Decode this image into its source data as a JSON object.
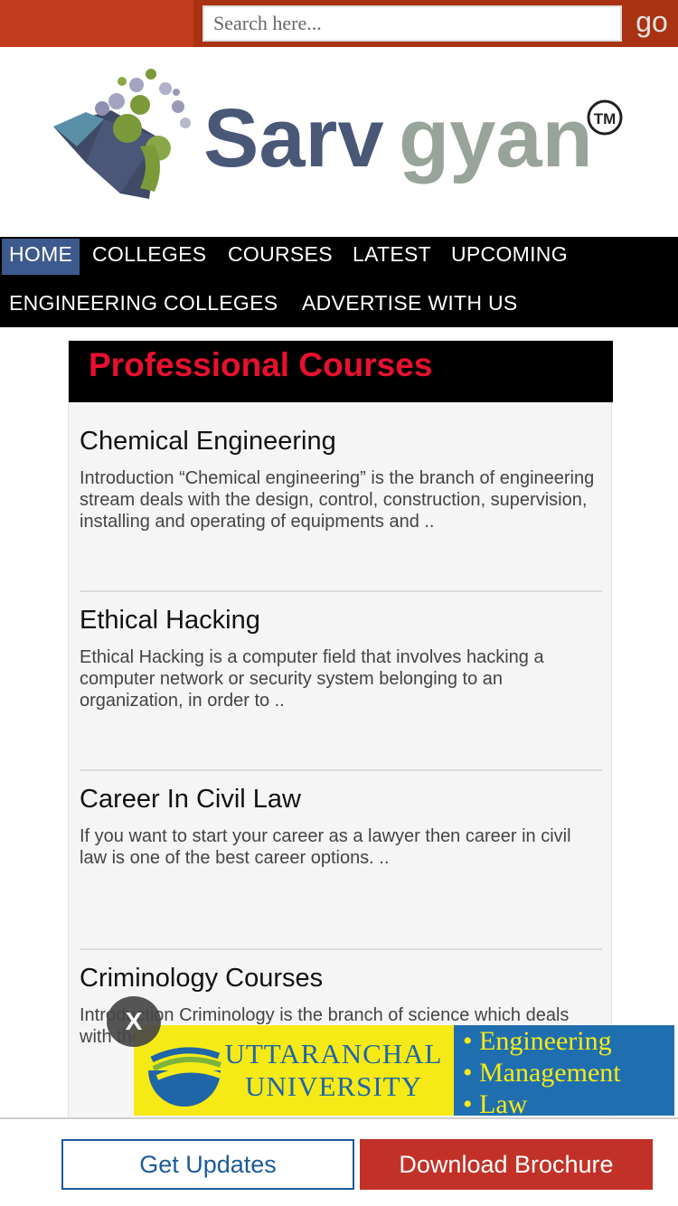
{
  "search": {
    "placeholder": "Search here...",
    "go_label": "go"
  },
  "logo": {
    "brand_part1": "Sarv",
    "brand_part2": "gyan",
    "trademark": "TM"
  },
  "nav": {
    "items": [
      {
        "label": "HOME",
        "active": true
      },
      {
        "label": "COLLEGES"
      },
      {
        "label": "COURSES"
      },
      {
        "label": "LATEST"
      },
      {
        "label": "UPCOMING"
      },
      {
        "label": "ENGINEERING COLLEGES"
      },
      {
        "label": "ADVERTISE WITH US"
      }
    ]
  },
  "panel": {
    "title": "Professional Courses",
    "courses": [
      {
        "title": "Chemical Engineering",
        "desc": "Introduction “Chemical engineering” is the branch of engineering stream deals with the design, control, construction, supervision, installing and operating of equipments and .."
      },
      {
        "title": "Ethical Hacking",
        "desc": "Ethical Hacking is a computer field that involves hacking a computer network or security system belonging to an organization, in order to .."
      },
      {
        "title": "Career In Civil Law",
        "desc": "If you want to start your career as a lawyer then career in civil law is one of the best career options. .."
      },
      {
        "title": "Criminology Courses",
        "desc": "Introduction Criminology is the branch of science which deals with the scientific study of crime and criminals. It is a science .."
      }
    ]
  },
  "ad": {
    "close_label": "X",
    "university_line1": "UTTARANCHAL",
    "university_line2": "UNIVERSITY",
    "programs": [
      "• Engineering",
      "• Management",
      "• Law"
    ]
  },
  "bottom": {
    "updates_label": "Get Updates",
    "brochure_label": "Download Brochure"
  },
  "colors": {
    "topbar": "#c23b1c",
    "nav_bg": "#000000",
    "nav_active": "#3d5a8e",
    "title_red": "#e8102f",
    "brochure_red": "#c23128",
    "updates_blue": "#1c5a9a"
  }
}
